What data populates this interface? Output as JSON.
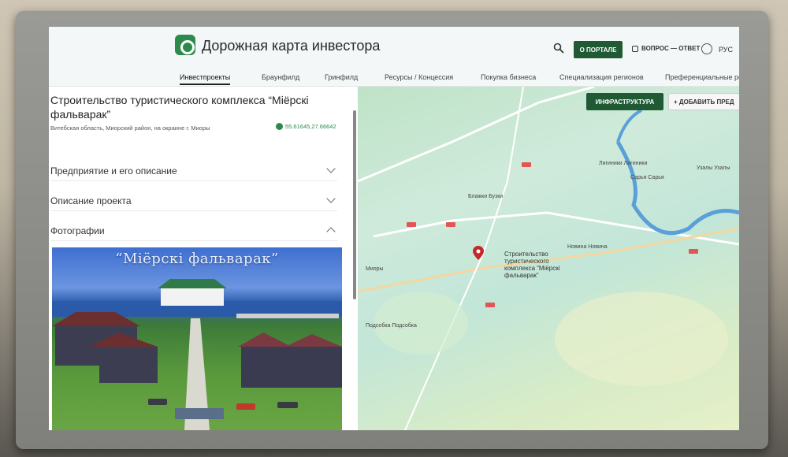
{
  "header": {
    "title": "Дорожная карта инвестора",
    "portal_button": "О ПОРТАЛЕ",
    "qa_link": "ВОПРОС — ОТВЕТ",
    "language": "РУС"
  },
  "tabs": [
    {
      "label": "Инвестпроекты",
      "active": true
    },
    {
      "label": "Браунфилд"
    },
    {
      "label": "Гринфилд"
    },
    {
      "label": "Ресурсы / Концессия"
    },
    {
      "label": "Покупка бизнеса"
    },
    {
      "label": "Специализация регионов"
    },
    {
      "label": "Преференциальные ре"
    }
  ],
  "project": {
    "title": "Строительство туристического комплекса “Міёрскі фальварак”",
    "address": "Витебская область, Миорский район, на окраине г. Миоры",
    "coords": "55.61645,27.66642"
  },
  "sections": [
    {
      "label": "Предприятие и его описание",
      "expanded": false
    },
    {
      "label": "Описание проекта",
      "expanded": false
    },
    {
      "label": "Фотографии",
      "expanded": true
    }
  ],
  "photo": {
    "caption": "“Міёрскі фальварак”"
  },
  "map": {
    "infra_button": "ИНФРАСТРУКТУРА",
    "add_button": "ДОБАВИТЬ ПРЕД",
    "project_label": "Строительство туристического комплекса “Міёрскі фальварак”",
    "labels": [
      {
        "text": "Миоры"
      },
      {
        "text": "Блажки Бузки"
      },
      {
        "text": "Подсобка Подсобка"
      },
      {
        "text": "Новина Новина"
      },
      {
        "text": "Лигиники Лигиники"
      },
      {
        "text": "Сарья Сарья"
      },
      {
        "text": "Узалы Узалы"
      }
    ]
  },
  "colors": {
    "accent": "#1f5a34",
    "brand": "#2e8a4a",
    "pin": "#c62828"
  }
}
